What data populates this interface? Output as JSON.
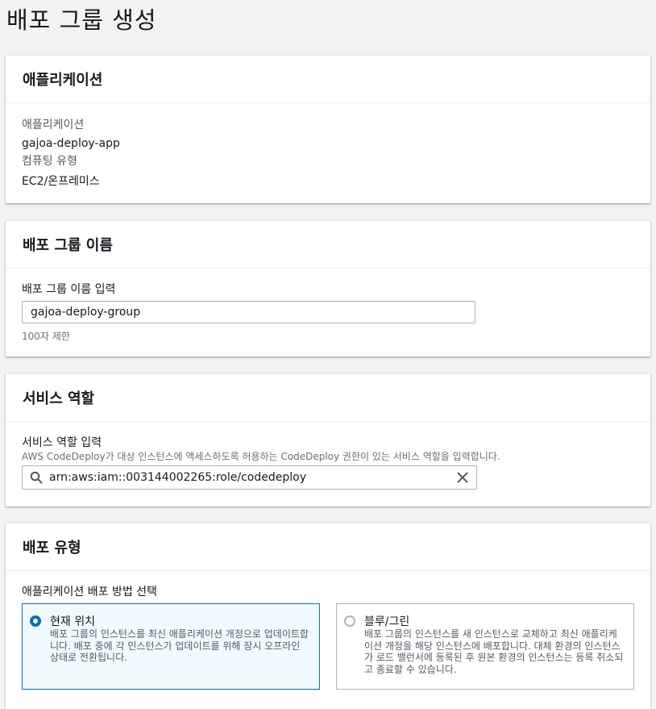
{
  "page": {
    "title": "배포 그룹 생성"
  },
  "application_section": {
    "header": "애플리케이션",
    "app_label": "애플리케이션",
    "app_value": "gajoa-deploy-app",
    "compute_label": "컴퓨팅 유형",
    "compute_value": "EC2/온프레미스"
  },
  "group_name_section": {
    "header": "배포 그룹 이름",
    "input_label": "배포 그룹 이름 입력",
    "input_value": "gajoa-deploy-group",
    "hint": "100자 제한"
  },
  "service_role_section": {
    "header": "서비스 역할",
    "input_label": "서비스 역할 입력",
    "description": "AWS CodeDeploy가 대상 인스턴스에 액세스하도록 허용하는 CodeDeploy 권한이 있는 서비스 역할을 입력합니다.",
    "input_value": "arn:aws:iam::003144002265:role/codedeploy"
  },
  "deployment_type_section": {
    "header": "배포 유형",
    "prompt": "애플리케이션 배포 방법 선택",
    "options": [
      {
        "title": "현재 위치",
        "description": "배포 그룹의 인스턴스를 최신 애플리케이션 개정으로 업데이트합니다. 배포 중에 각 인스턴스가 업데이트를 위해 잠시 오프라인 상태로 전환됩니다.",
        "selected": true
      },
      {
        "title": "블루/그린",
        "description": "배포 그룹의 인스턴스를 새 인스턴스로 교체하고 최신 애플리케이션 개정을 해당 인스턴스에 배포합니다. 대체 환경의 인스턴스가 로드 밸런서에 등록된 후 원본 환경의 인스턴스는 등록 취소되고 종료할 수 있습니다.",
        "selected": false
      }
    ]
  },
  "colors": {
    "accent": "#0073bb",
    "selected_tile_bg": "#f1faff",
    "page_bg": "#f2f3f3"
  }
}
